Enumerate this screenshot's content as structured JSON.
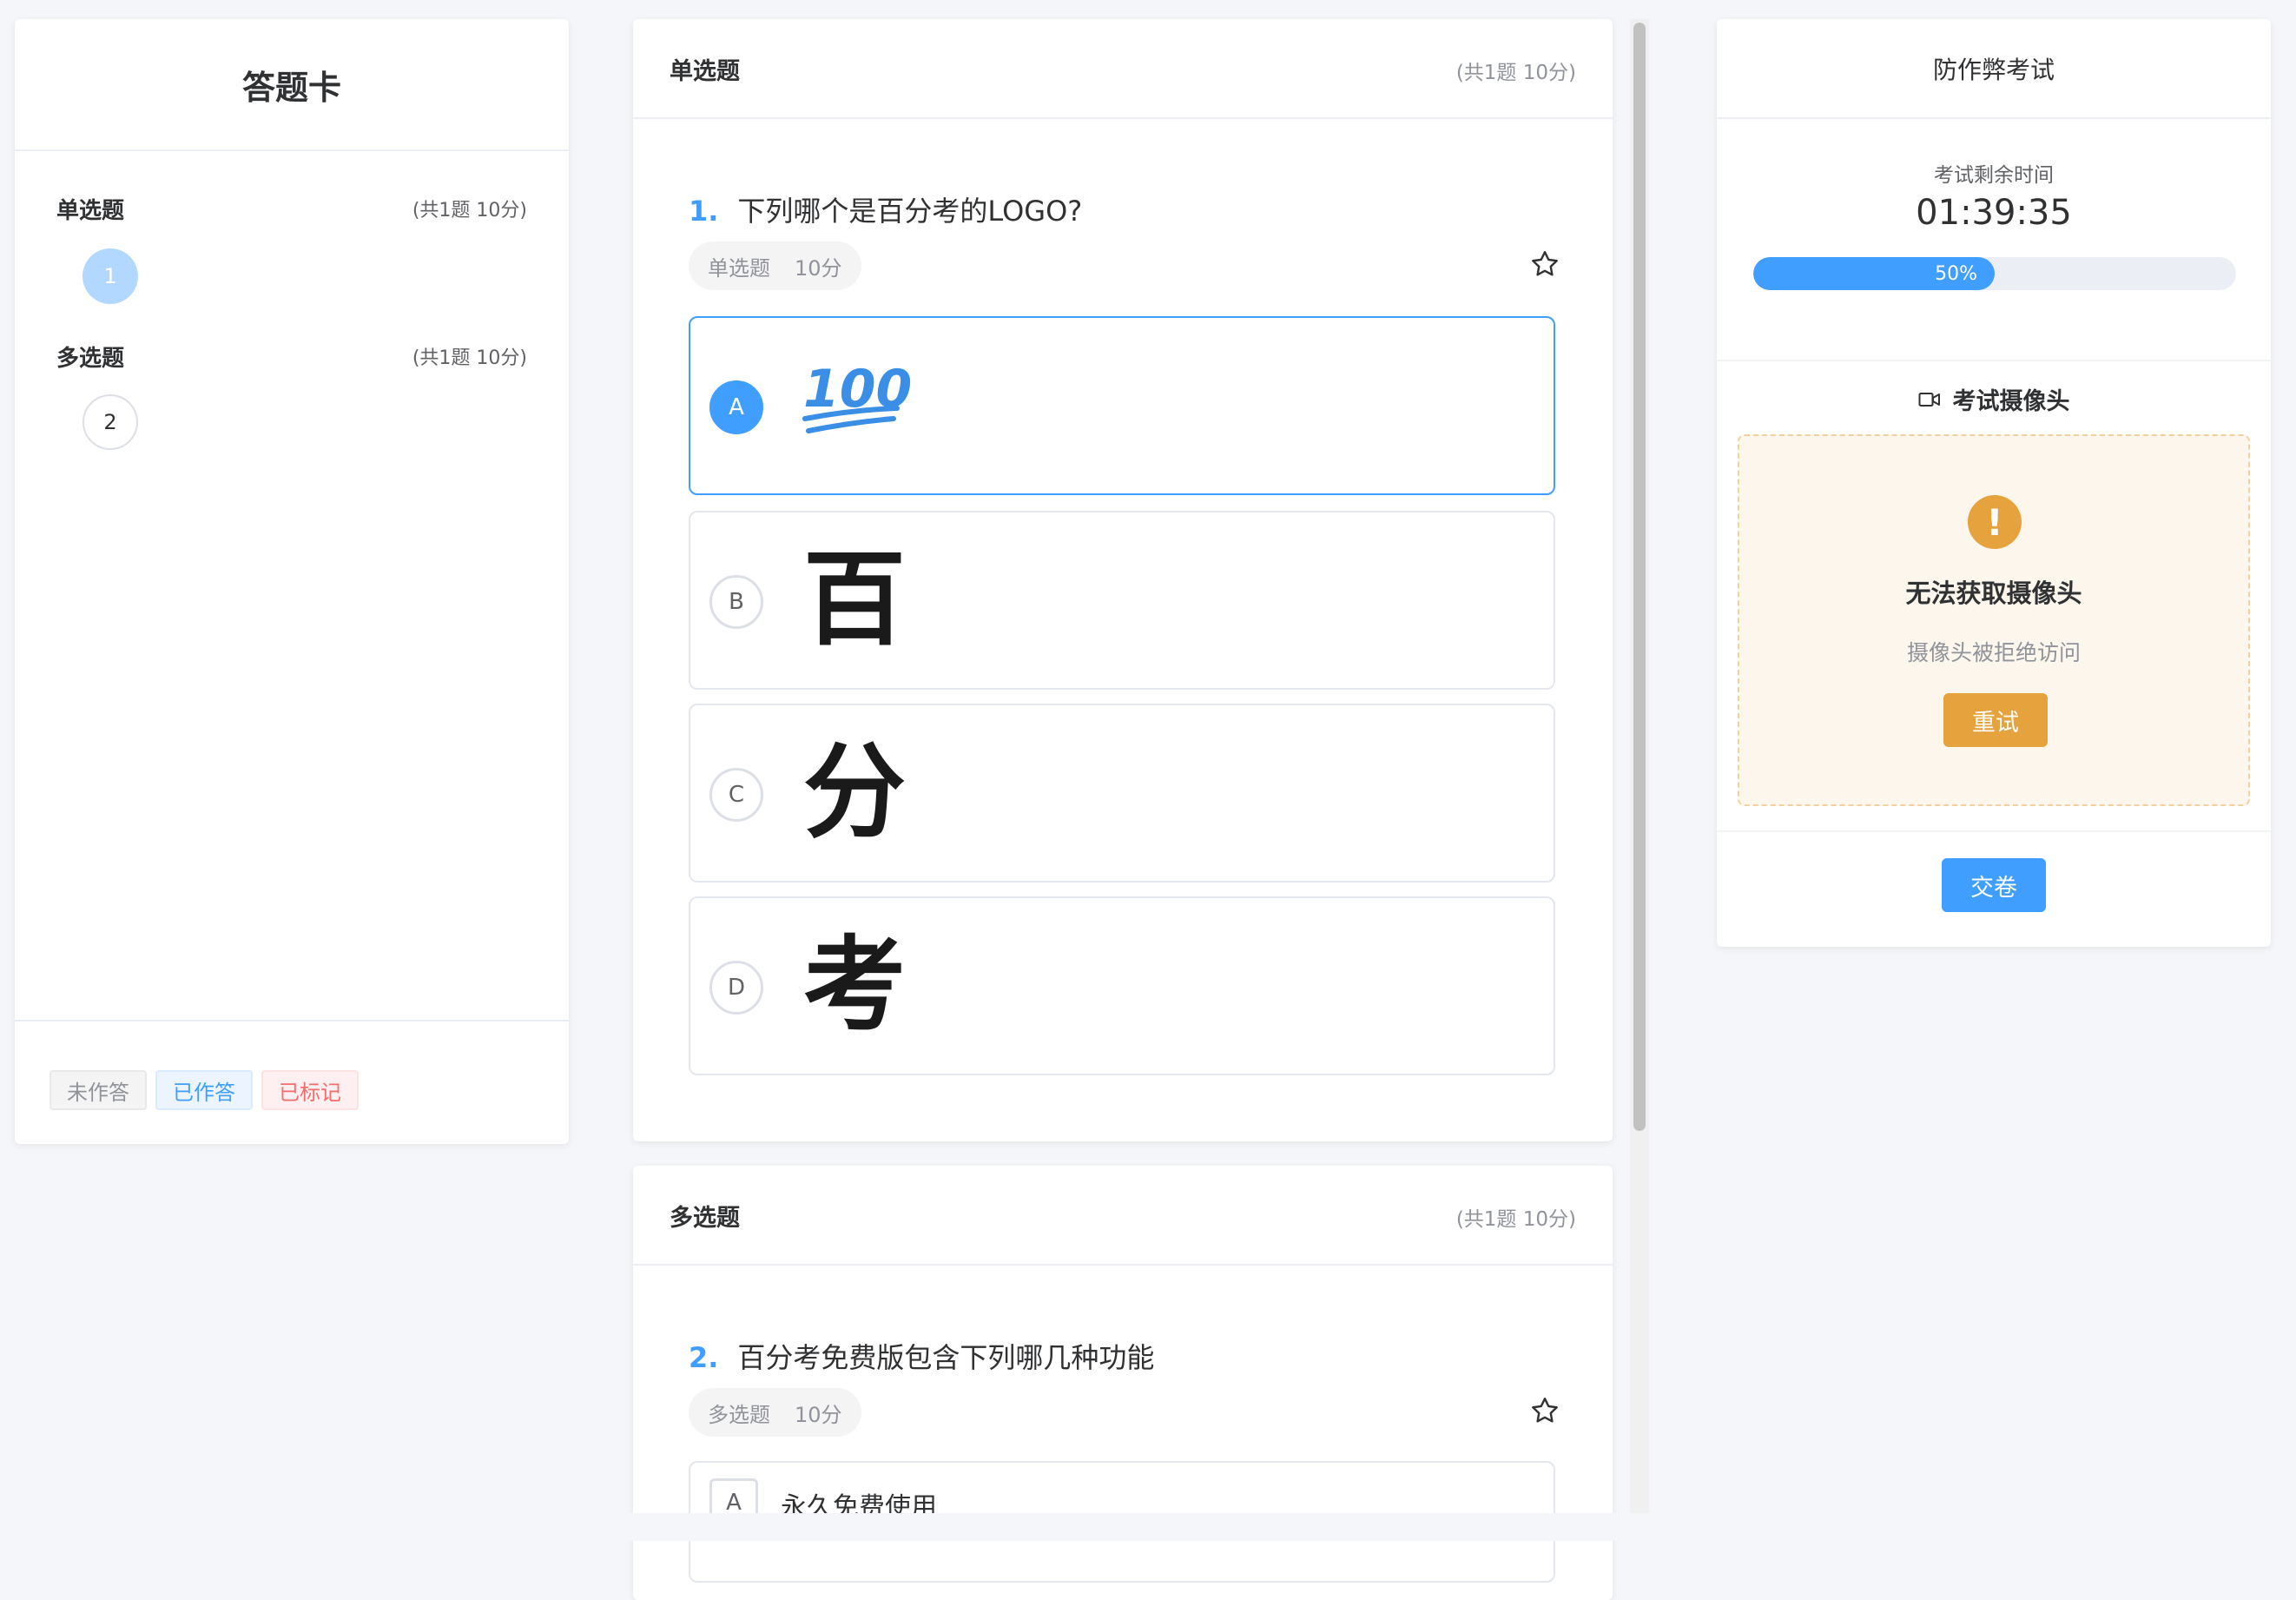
{
  "answer_card": {
    "title": "答题卡",
    "sections": [
      {
        "title": "单选题",
        "meta": "(共1题 10分)",
        "numbers": [
          "1"
        ]
      },
      {
        "title": "多选题",
        "meta": "(共1题 10分)",
        "numbers": [
          "2"
        ]
      }
    ],
    "legend": {
      "unanswered": "未作答",
      "answered": "已作答",
      "marked": "已标记"
    }
  },
  "single_section": {
    "title": "单选题",
    "meta": "(共1题 10分)",
    "question": {
      "number": "1.",
      "text": "下列哪个是百分考的LOGO?",
      "type": "单选题",
      "score": "10分",
      "options": [
        {
          "letter": "A",
          "glyph": "100",
          "selected": true
        },
        {
          "letter": "B",
          "glyph": "百"
        },
        {
          "letter": "C",
          "glyph": "分"
        },
        {
          "letter": "D",
          "glyph": "考"
        }
      ]
    }
  },
  "multi_section": {
    "title": "多选题",
    "meta": "(共1题 10分)",
    "question": {
      "number": "2.",
      "text": "百分考免费版包含下列哪几种功能",
      "type": "多选题",
      "score": "10分",
      "options": [
        {
          "letter": "A",
          "text": "永久免费使用"
        }
      ]
    }
  },
  "exam_panel": {
    "title": "防作弊考试",
    "remaining_label": "考试剩余时间",
    "remaining_time": "01:39:35",
    "progress_percent": 50,
    "progress_label": "50%",
    "camera": {
      "title": "考试摄像头",
      "error": "无法获取摄像头",
      "sub": "摄像头被拒绝访问",
      "retry": "重试"
    },
    "submit": "交卷"
  },
  "colors": {
    "primary": "#409eff",
    "warning": "#e6a23c",
    "danger": "#f56c6c"
  }
}
